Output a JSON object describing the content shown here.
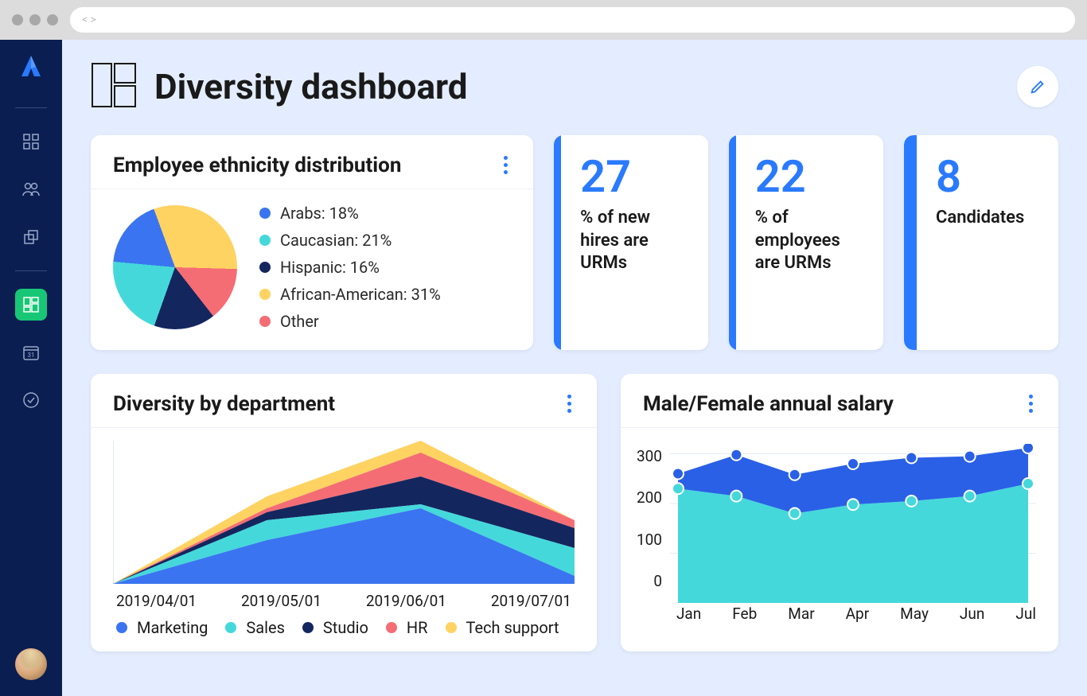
{
  "header": {
    "title": "Diversity dashboard"
  },
  "ethnicity": {
    "title": "Employee ethnicity distribution",
    "legend": {
      "arabs": "Arabs: 18%",
      "caucasian": "Caucasian: 21%",
      "hispanic": "Hispanic: 16%",
      "african": "African-American: 31%",
      "other": "Other"
    },
    "colors": {
      "arabs": "#3a74f0",
      "caucasian": "#44d8db",
      "hispanic": "#14265e",
      "african": "#ffd362",
      "other": "#f56d74"
    }
  },
  "stats": {
    "hires": {
      "value": "27",
      "label": "% of new hires are URMs"
    },
    "employees": {
      "value": "22",
      "label": "% of employees are URMs"
    },
    "candidates": {
      "value": "8",
      "label": "Candidates"
    }
  },
  "department": {
    "title": "Diversity by department",
    "x": [
      "2019/04/01",
      "2019/05/01",
      "2019/06/01",
      "2019/07/01"
    ],
    "legend": {
      "marketing": "Marketing",
      "sales": "Sales",
      "studio": "Studio",
      "hr": "HR",
      "tech": "Tech support"
    }
  },
  "salary": {
    "title": "Male/Female annual salary",
    "y": {
      "t300": "300",
      "t200": "200",
      "t100": "100",
      "t0": "0"
    },
    "x": {
      "jan": "Jan",
      "feb": "Feb",
      "mar": "Mar",
      "apr": "Apr",
      "may": "May",
      "jun": "Jun",
      "jul": "Jul"
    }
  },
  "chart_data": [
    {
      "type": "pie",
      "title": "Employee ethnicity distribution",
      "slices": [
        {
          "label": "Arabs",
          "value": 18,
          "color": "#3a74f0"
        },
        {
          "label": "Caucasian",
          "value": 21,
          "color": "#44d8db"
        },
        {
          "label": "Hispanic",
          "value": 16,
          "color": "#14265e"
        },
        {
          "label": "African-American",
          "value": 31,
          "color": "#ffd362"
        },
        {
          "label": "Other",
          "value": 14,
          "color": "#f56d74"
        }
      ]
    },
    {
      "type": "area",
      "title": "Diversity by department",
      "x": [
        "2019/04/01",
        "2019/05/01",
        "2019/06/01",
        "2019/07/01"
      ],
      "series": [
        {
          "name": "Marketing",
          "color": "#3a74f0",
          "values": [
            0,
            55,
            95,
            10
          ]
        },
        {
          "name": "Sales",
          "color": "#44d8db",
          "values": [
            0,
            25,
            5,
            35
          ]
        },
        {
          "name": "Studio",
          "color": "#14265e",
          "values": [
            0,
            10,
            35,
            25
          ]
        },
        {
          "name": "HR",
          "color": "#f56d74",
          "values": [
            0,
            5,
            30,
            10
          ]
        },
        {
          "name": "Tech support",
          "color": "#ffd362",
          "values": [
            0,
            15,
            15,
            0
          ]
        }
      ],
      "ylim": [
        0,
        180
      ]
    },
    {
      "type": "area",
      "title": "Male/Female annual salary",
      "x": [
        "Jan",
        "Feb",
        "Mar",
        "Apr",
        "May",
        "Jun",
        "Jul"
      ],
      "ylim": [
        0,
        320
      ],
      "series": [
        {
          "name": "Male",
          "color": "#2a60e6",
          "values": [
            260,
            298,
            258,
            280,
            292,
            295,
            312
          ]
        },
        {
          "name": "Female",
          "color": "#44d8db",
          "values": [
            230,
            215,
            180,
            198,
            205,
            215,
            240
          ]
        }
      ]
    }
  ]
}
